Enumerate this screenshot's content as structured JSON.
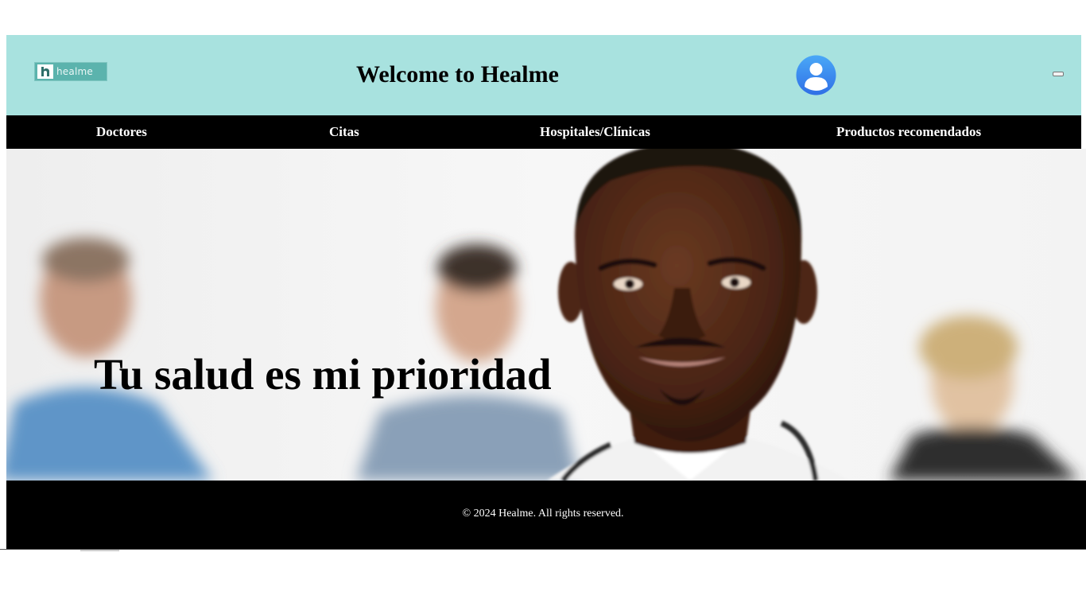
{
  "header": {
    "logo_text": "healme",
    "title": "Welcome to Healme",
    "avatar_icon": "user-avatar-icon",
    "minimize_icon": "minimize-icon"
  },
  "nav": {
    "items": [
      {
        "label": "Doctores"
      },
      {
        "label": "Citas"
      },
      {
        "label": "Hospitales/Clínicas"
      },
      {
        "label": "Productos recomendados"
      }
    ]
  },
  "hero": {
    "headline": "Tu salud es mi prioridad"
  },
  "footer": {
    "copyright": "© 2024 Healme. All rights reserved."
  },
  "colors": {
    "header_bg": "#a8e2df",
    "nav_bg": "#000000",
    "footer_bg": "#000000",
    "avatar_blue": "#3b8ef3",
    "logo_teal": "#5bb3ad"
  }
}
